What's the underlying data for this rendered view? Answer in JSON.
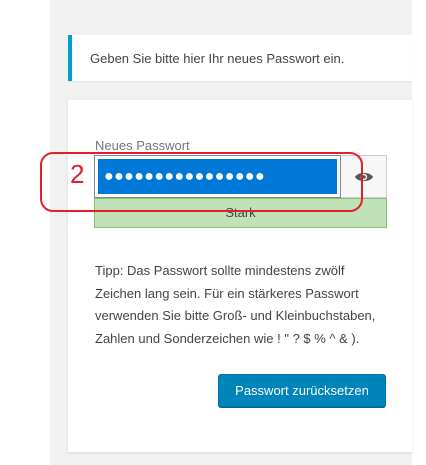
{
  "message": {
    "text": "Geben Sie bitte hier Ihr neues Passwort ein."
  },
  "form": {
    "password_label": "Neues Passwort",
    "password_masked": "●●●●●●●●●●●●●●●●",
    "show_password_icon": "eye-icon",
    "strength_label": "Stark",
    "tip": "Tipp: Das Passwort sollte mindestens zwölf Zeichen lang sein. Für ein stärkeres Passwort verwenden Sie bitte Groß- und Kleinbuchstaben, Zahlen und Sonderzeichen wie ! \" ? $ % ^ & ).",
    "submit_label": "Passwort zurücksetzen"
  },
  "annotation": {
    "number": "2"
  },
  "colors": {
    "accent": "#00a0d2",
    "primary_button": "#0085ba",
    "selection": "#0078d7",
    "strength_strong_bg": "#c1e1b9",
    "strength_strong_border": "#83c373",
    "annotation_red": "#e0202e"
  }
}
